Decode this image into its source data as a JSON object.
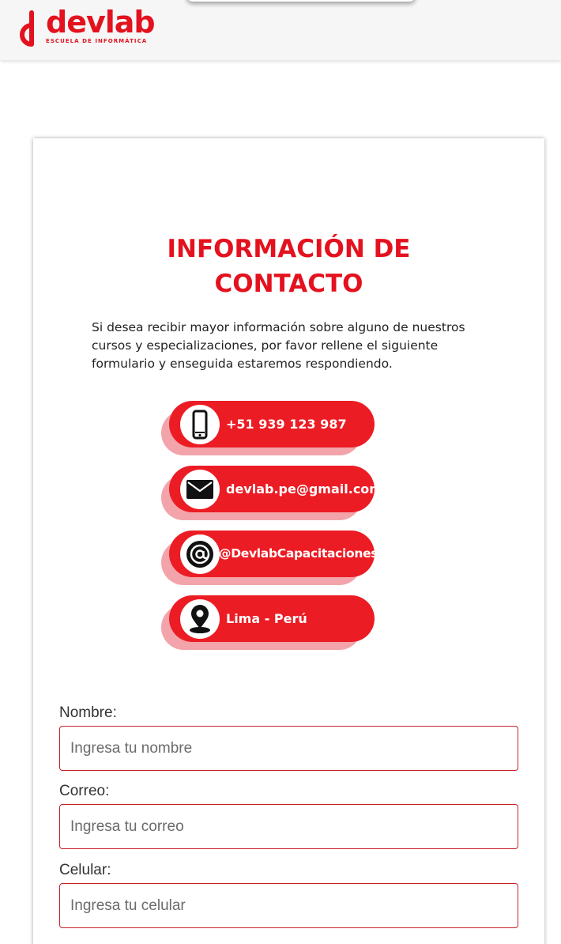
{
  "brand": {
    "name": "devlab",
    "subtitle": "ESCUELA DE INFORMÁTICA",
    "color": "#e3121e"
  },
  "contact": {
    "title_line1": "INFORMACIÓN DE",
    "title_line2": "CONTACTO",
    "description": "Si desea recibir mayor información sobre alguno de nuestros cursos y especializaciones, por favor rellene el siguiente formulario y enseguida estaremos respondiendo.",
    "items": [
      {
        "icon": "phone-icon",
        "text": "+51 939 123 987"
      },
      {
        "icon": "envelope-icon",
        "text": "devlab.pe@gmail.com"
      },
      {
        "icon": "at-sign-icon",
        "text": "@DevlabCapacitaciones"
      },
      {
        "icon": "location-pin-icon",
        "text": "Lima - Perú"
      }
    ]
  },
  "form": {
    "name_label": "Nombre:",
    "name_placeholder": "Ingresa tu nombre",
    "email_label": "Correo:",
    "email_placeholder": "Ingresa tu correo",
    "phone_label": "Celular:",
    "phone_placeholder": "Ingresa tu celular"
  }
}
